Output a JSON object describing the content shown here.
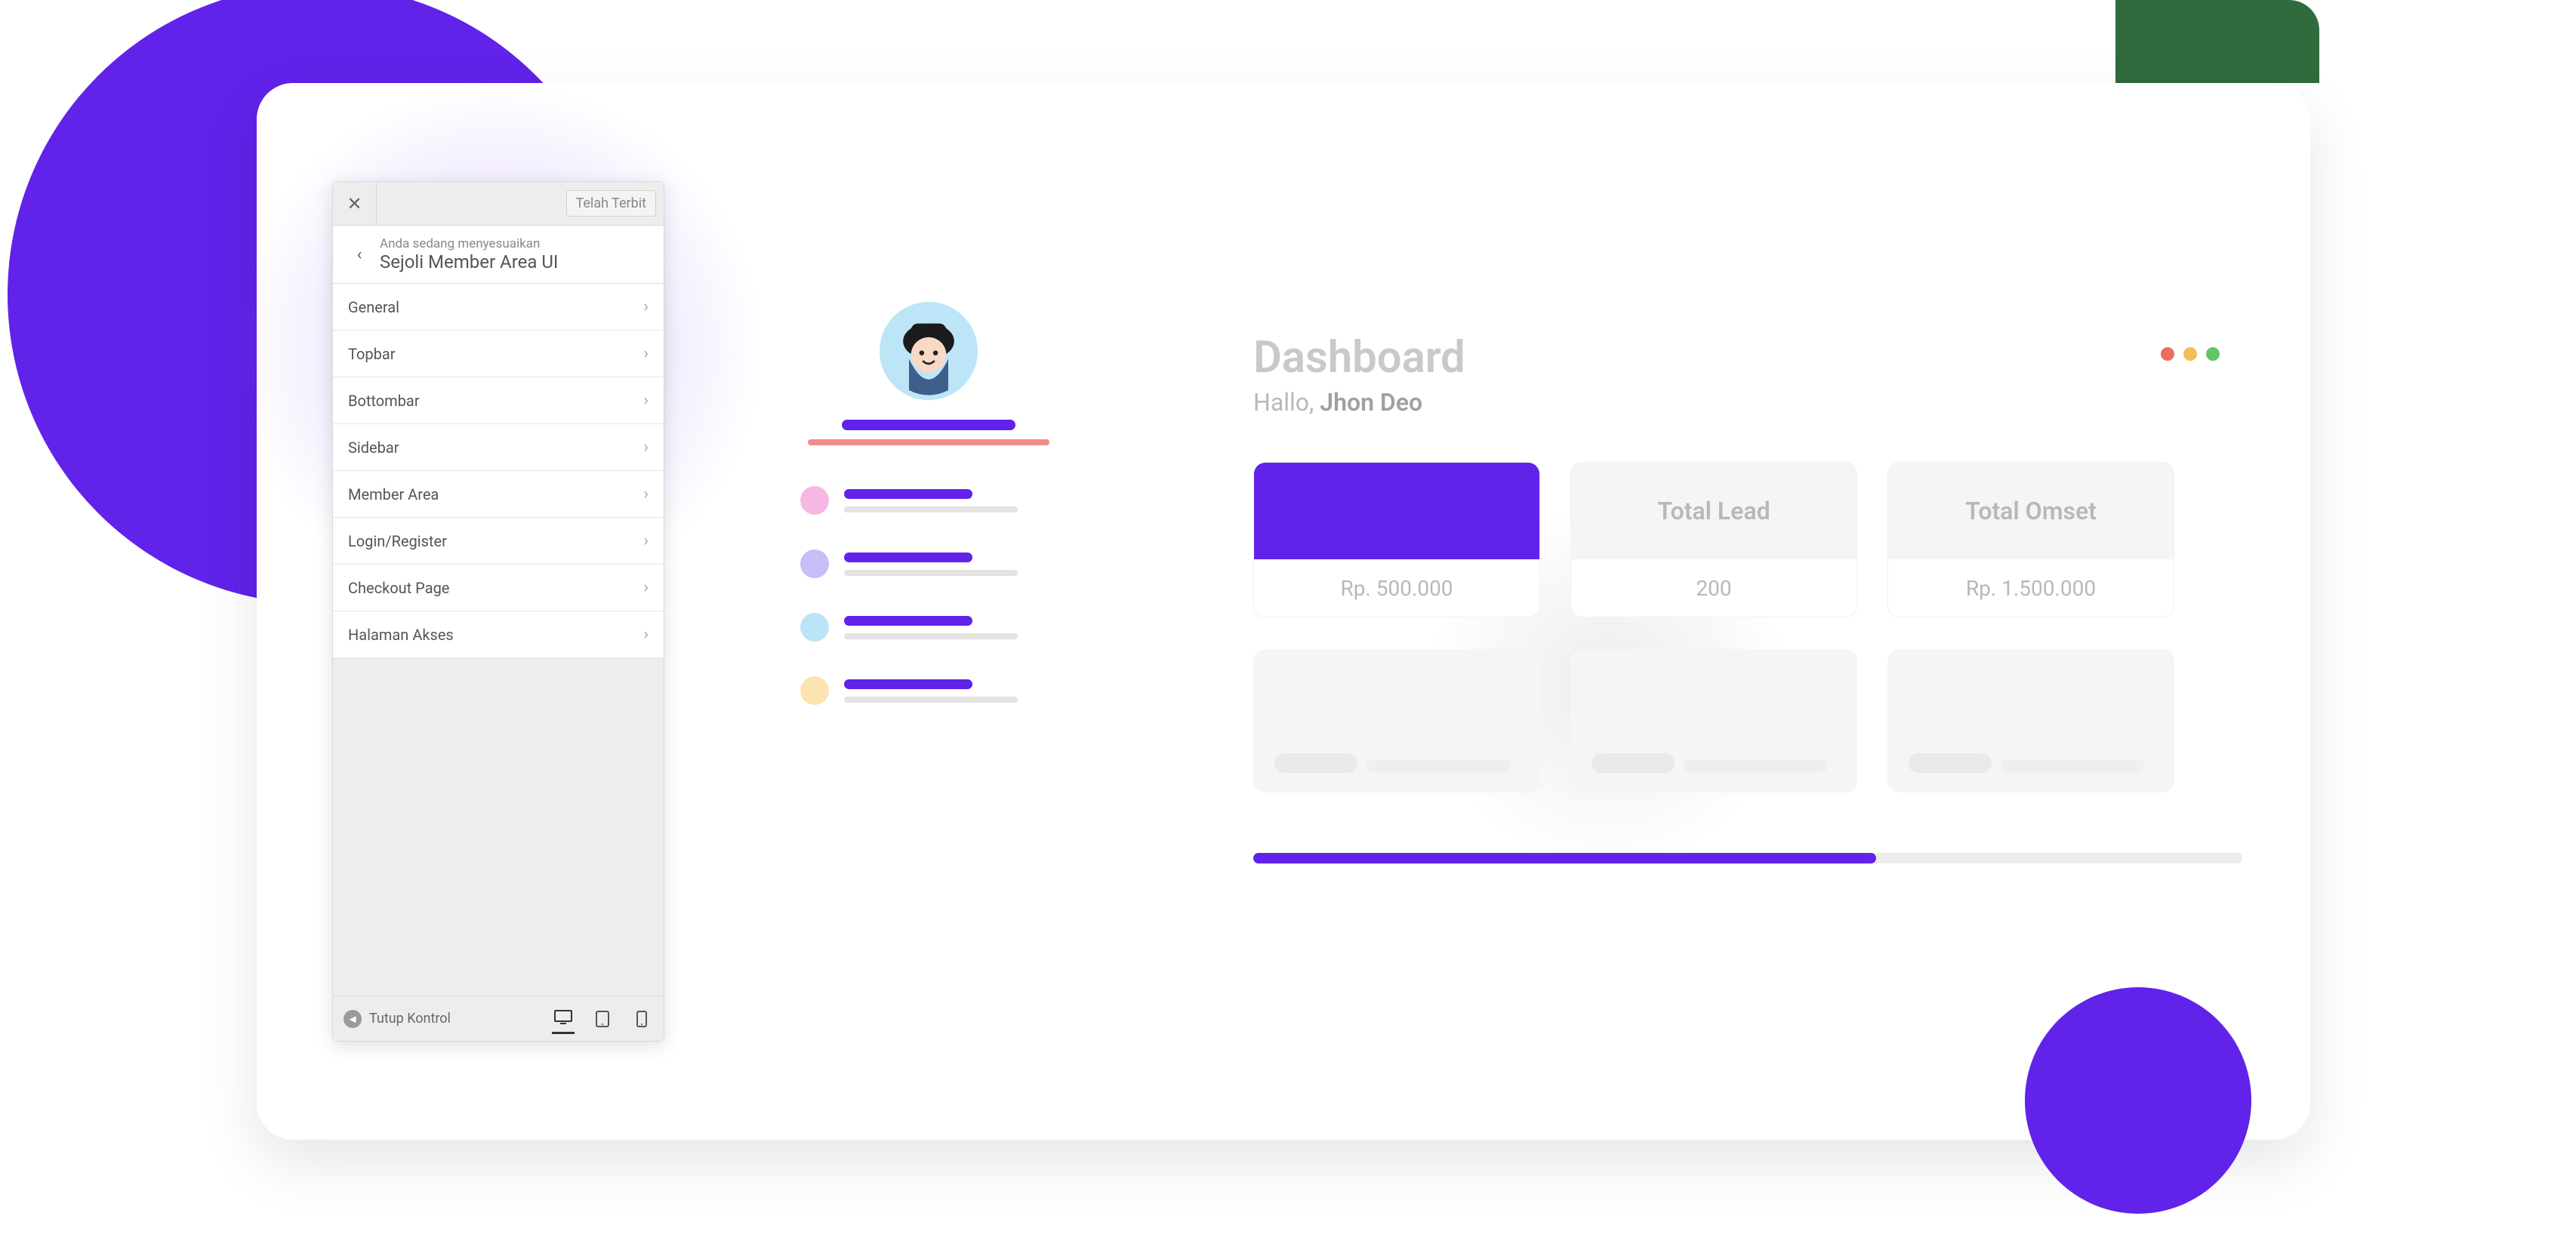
{
  "colors": {
    "primary": "#6122EA",
    "coral": "#F28B8B",
    "green": "#2F6B3C",
    "dot_red": "#F06D5E",
    "dot_yellow": "#F3BE58",
    "dot_green": "#63C466"
  },
  "customizer": {
    "publish_label": "Telah Terbit",
    "context_label": "Anda sedang menyesuaikan",
    "title": "Sejoli Member Area UI",
    "items": [
      {
        "label": "General"
      },
      {
        "label": "Topbar"
      },
      {
        "label": "Bottombar"
      },
      {
        "label": "Sidebar"
      },
      {
        "label": "Member Area"
      },
      {
        "label": "Login/Register"
      },
      {
        "label": "Checkout Page"
      },
      {
        "label": "Halaman Akses"
      }
    ],
    "collapse_label": "Tutup Kontrol",
    "device_active": "desktop"
  },
  "sidebar_mock": {
    "items": [
      {
        "dot_color": "#F6B8E2"
      },
      {
        "dot_color": "#C8BDF7"
      },
      {
        "dot_color": "#BDE3F8"
      },
      {
        "dot_color": "#FCE3B0"
      }
    ]
  },
  "dashboard": {
    "title": "Dashboard",
    "greeting_prefix": "Hallo, ",
    "greeting_name": "Jhon Deo",
    "stats": [
      {
        "label": "",
        "value": "Rp. 500.000",
        "highlight": true
      },
      {
        "label": "Total Lead",
        "value": "200",
        "highlight": false
      },
      {
        "label": "Total Omset",
        "value": "Rp. 1.500.000",
        "highlight": false
      }
    ],
    "progress_percent": 63
  }
}
